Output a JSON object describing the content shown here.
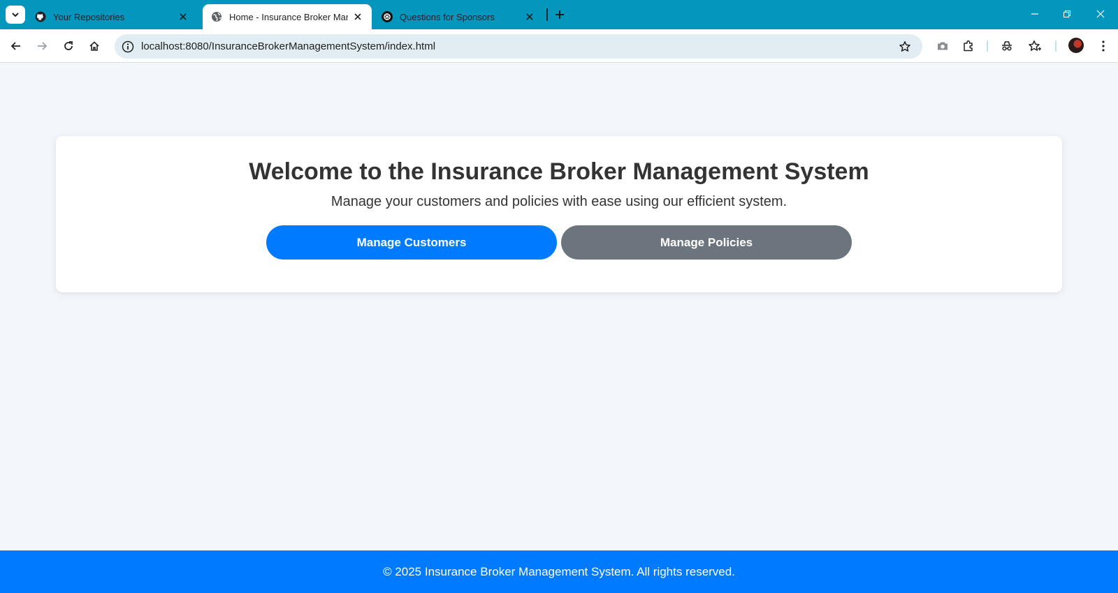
{
  "browser": {
    "tabs": [
      {
        "title": "Your Repositories",
        "icon": "github-icon",
        "active": false
      },
      {
        "title": "Home - Insurance Broker Management System",
        "icon": "globe-icon",
        "active": true
      },
      {
        "title": "Questions for Sponsors",
        "icon": "openai-icon",
        "active": false
      }
    ],
    "url": "localhost:8080/InsuranceBrokerManagementSystem/index.html"
  },
  "page": {
    "title": "Welcome to the Insurance Broker Management System",
    "subtitle": "Manage your customers and policies with ease using our efficient system.",
    "buttons": {
      "customers": "Manage Customers",
      "policies": "Manage Policies"
    },
    "footer": "© 2025 Insurance Broker Management System. All rights reserved."
  },
  "colors": {
    "chrome_accent": "#0397bd",
    "primary": "#007bff",
    "secondary": "#6c757d",
    "page_background": "#f3f7fb"
  }
}
